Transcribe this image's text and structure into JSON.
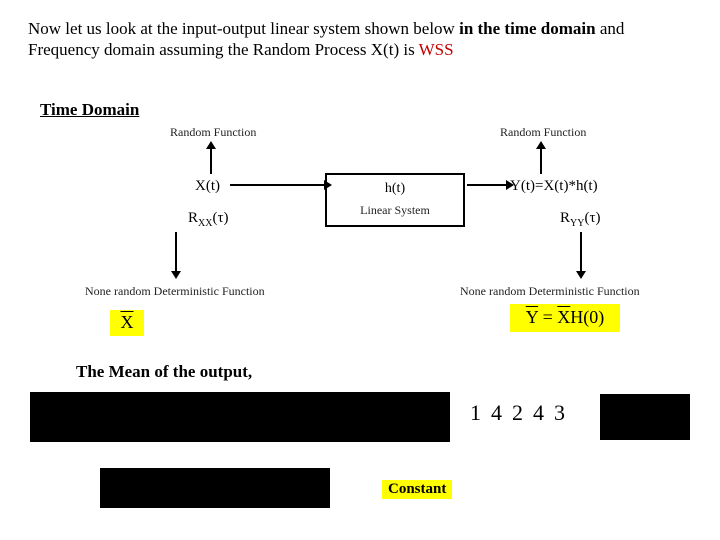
{
  "intro": {
    "part1": " Now let us look at the input-output linear system shown below ",
    "bold1": "in the time domain",
    "part2": " and Frequency domain assuming  the Random Process X(t) is ",
    "wss": "WSS"
  },
  "section_heading": "Time Domain",
  "diagram": {
    "random_function": "Random  Function",
    "xt": "X(t)",
    "rxx_base": "R",
    "rxx_sub": "XX",
    "rxx_arg": "(τ)",
    "ht": "h(t)",
    "linear_system": "Linear System",
    "yt": "Y(t)=X(t)*h(t)",
    "ryy_base": "R",
    "ryy_sub": "YY",
    "ryy_arg": "(τ)",
    "nrd": "None random Deterministic Function"
  },
  "highlights": {
    "xbar": "X",
    "ybar_lhs": "Y",
    "ybar_rhs_x": "X",
    "ybar_rhs_h": "H(0)",
    "numbers": "14243",
    "constant": "Constant"
  },
  "mean_heading": "The Mean of the output,"
}
